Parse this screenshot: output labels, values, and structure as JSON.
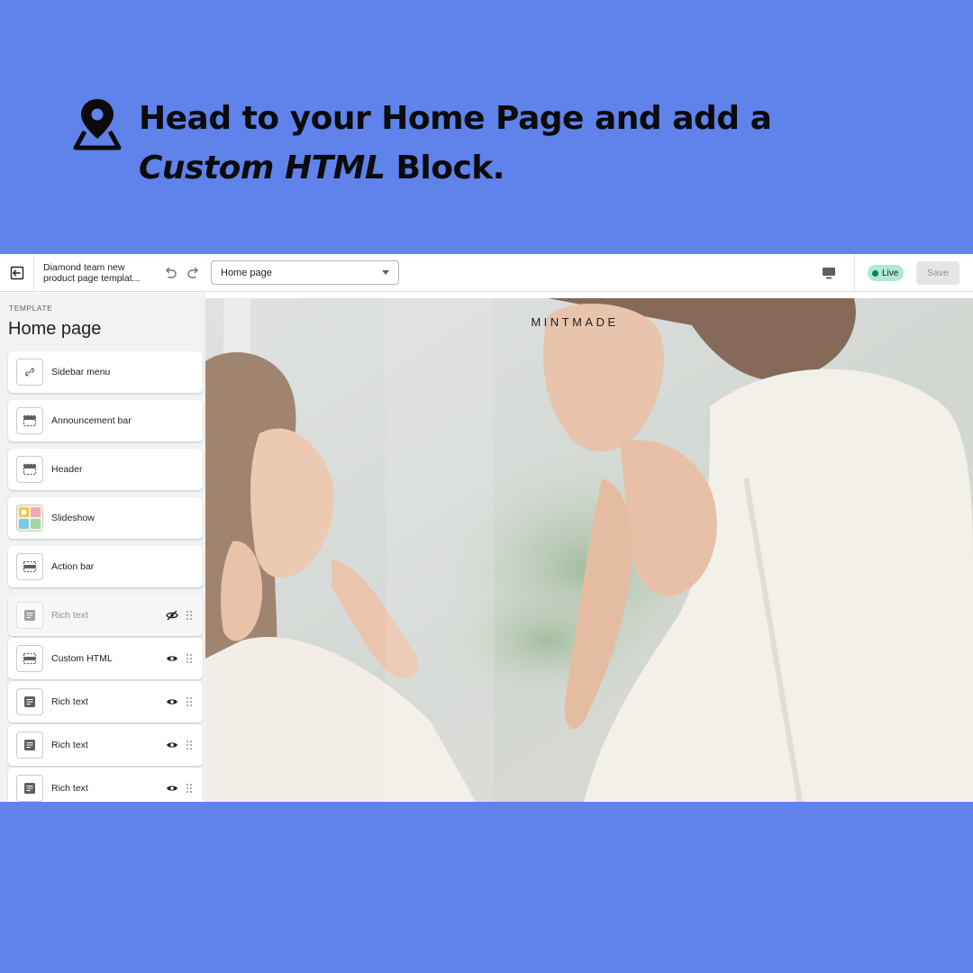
{
  "headline": {
    "line1": "Head to your Home Page and add a",
    "line2_italic": "Custom HTML",
    "line2_rest": " Block."
  },
  "topbar": {
    "theme_name": "Diamond team new product page templat...",
    "page_select": "Home page",
    "live_label": "Live",
    "save_label": "Save"
  },
  "sidebar": {
    "template_label": "TEMPLATE",
    "title": "Home page",
    "items": [
      {
        "label": "Sidebar menu",
        "icon": "link-icon"
      },
      {
        "label": "Announcement bar",
        "icon": "announcement-bar-icon"
      },
      {
        "label": "Header",
        "icon": "header-icon"
      },
      {
        "label": "Slideshow",
        "icon": "slideshow-thumbnail"
      },
      {
        "label": "Action bar",
        "icon": "action-bar-icon"
      },
      {
        "label": "Rich text",
        "icon": "text-icon",
        "hidden": true
      },
      {
        "label": "Custom HTML",
        "icon": "custom-html-icon"
      },
      {
        "label": "Rich text",
        "icon": "text-icon"
      },
      {
        "label": "Rich text",
        "icon": "text-icon"
      },
      {
        "label": "Rich text",
        "icon": "text-icon"
      }
    ]
  },
  "preview": {
    "brand": "MINTMADE"
  },
  "colors": {
    "background": "#5f82eb",
    "live_badge": "#aee9d1",
    "live_dot": "#007f5f"
  }
}
